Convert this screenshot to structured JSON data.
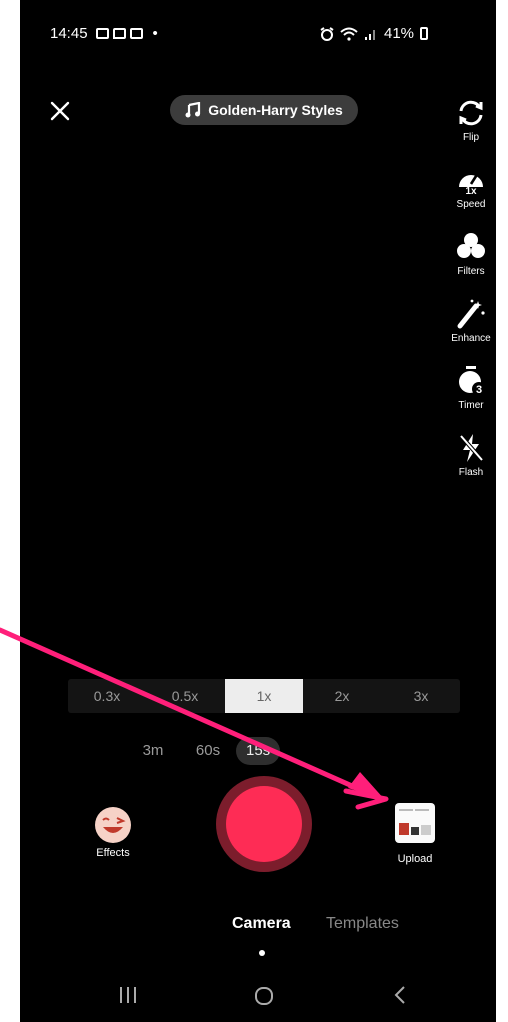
{
  "status_bar": {
    "time": "14:45",
    "dot": "•",
    "battery": "41%"
  },
  "top": {
    "music_title": "Golden-Harry Styles"
  },
  "side_tools": [
    {
      "label": "Flip",
      "icon": "flip-icon"
    },
    {
      "label": "Speed",
      "icon": "speed-icon",
      "badge": "1x"
    },
    {
      "label": "Filters",
      "icon": "filters-icon"
    },
    {
      "label": "Enhance",
      "icon": "enhance-icon"
    },
    {
      "label": "Timer",
      "icon": "timer-icon",
      "badge": "3"
    },
    {
      "label": "Flash",
      "icon": "flash-icon"
    }
  ],
  "zoom_options": [
    "0.3x",
    "0.5x",
    "1x",
    "2x",
    "3x"
  ],
  "zoom_selected": "1x",
  "durations": [
    "3m",
    "60s",
    "15s"
  ],
  "duration_selected": "15s",
  "effects": {
    "label": "Effects",
    "icon": "smiley-face-icon"
  },
  "upload": {
    "label": "Upload",
    "icon": "gallery-thumbnail-icon"
  },
  "mode_tabs": [
    {
      "label": "Camera",
      "active": true
    },
    {
      "label": "Templates",
      "active": false
    }
  ],
  "nav": {
    "recents": "|||",
    "home": "O",
    "back": "<"
  },
  "colors": {
    "record": "#fe2c55",
    "record_ring": "#7c1d2c",
    "arrow": "#ff1f7a",
    "background": "#000000"
  }
}
